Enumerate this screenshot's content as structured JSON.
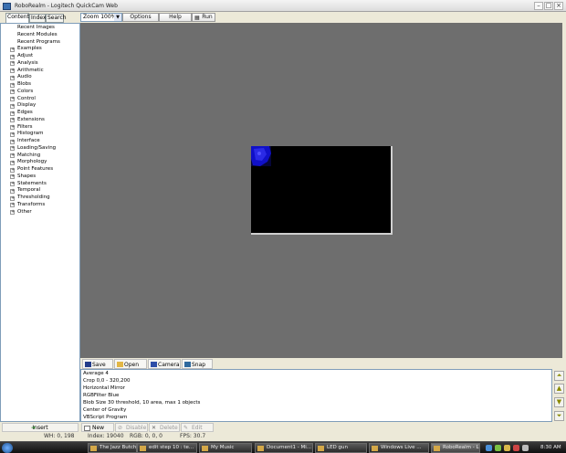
{
  "window": {
    "title": "RoboRealm - Logitech QuickCam Web"
  },
  "tabs": [
    "Contents",
    "Index",
    "Search"
  ],
  "toolbar": {
    "zoom_value": "Zoom 100%",
    "options": "Options",
    "help": "Help",
    "run": "Run"
  },
  "tree": {
    "items": [
      {
        "label": "Recent Images",
        "expandable": false
      },
      {
        "label": "Recent Modules",
        "expandable": false
      },
      {
        "label": "Recent Programs",
        "expandable": false
      },
      {
        "label": "Examples",
        "expandable": true
      },
      {
        "label": "Adjust",
        "expandable": true
      },
      {
        "label": "Analysis",
        "expandable": true
      },
      {
        "label": "Arithmetic",
        "expandable": true
      },
      {
        "label": "Audio",
        "expandable": true
      },
      {
        "label": "Blobs",
        "expandable": true
      },
      {
        "label": "Colors",
        "expandable": true
      },
      {
        "label": "Control",
        "expandable": true
      },
      {
        "label": "Display",
        "expandable": true
      },
      {
        "label": "Edges",
        "expandable": true
      },
      {
        "label": "Extensions",
        "expandable": true
      },
      {
        "label": "Filters",
        "expandable": true
      },
      {
        "label": "Histogram",
        "expandable": true
      },
      {
        "label": "Interface",
        "expandable": true
      },
      {
        "label": "Loading/Saving",
        "expandable": true
      },
      {
        "label": "Matching",
        "expandable": true
      },
      {
        "label": "Morphology",
        "expandable": true
      },
      {
        "label": "Point Features",
        "expandable": true
      },
      {
        "label": "Shapes",
        "expandable": true
      },
      {
        "label": "Statements",
        "expandable": true
      },
      {
        "label": "Temporal",
        "expandable": true
      },
      {
        "label": "Thresholding",
        "expandable": true
      },
      {
        "label": "Transforms",
        "expandable": true
      },
      {
        "label": "Other",
        "expandable": true
      }
    ]
  },
  "pipeline_toolbar": {
    "save": "Save",
    "open": "Open",
    "camera": "Camera",
    "snap": "Snap"
  },
  "pipeline": {
    "items": [
      "Average 4",
      "Crop 0,0 - 320,200",
      "Horizontal Mirror",
      "RGBFilter Blue",
      "Blob Size 30 threshold, 10 area, max 1 objects",
      "Center of Gravity",
      "VBScript Program"
    ]
  },
  "bottom_buttons": {
    "insert": "Insert",
    "new": "New",
    "disable": "Disable",
    "delete": "Delete",
    "edit": "Edit"
  },
  "status": {
    "wh": "WH: 0, 198",
    "index": "Index: 19040",
    "rgb": "RGB: 0, 0, 0",
    "fps": "FPS: 30.7"
  },
  "taskbar": {
    "tasks": [
      {
        "label": "The Jazz Butch...",
        "active": false
      },
      {
        "label": "edit step 10 : te...",
        "active": false
      },
      {
        "label": "My Music",
        "active": false
      },
      {
        "label": "Document1 - Mi...",
        "active": false
      },
      {
        "label": "LED gun",
        "active": false
      },
      {
        "label": "Windows Live ...",
        "active": false
      },
      {
        "label": "RoboRealm - L...",
        "active": true
      }
    ],
    "time": "8:30 AM"
  },
  "colors": {
    "canvas_bg": "#6e6e6e",
    "blob": "#1010c8",
    "taskbar": "#1a1a1a"
  },
  "icons": {
    "title": "roborealm-app-icon",
    "run": "run-icon",
    "save": "floppy-disk-icon",
    "open": "folder-open-icon",
    "camera": "camera-icon",
    "snap": "snapshot-icon",
    "insert": "insert-arrow-icon",
    "new": "new-document-icon",
    "disable": "disable-icon",
    "delete": "delete-x-icon",
    "edit": "edit-icon"
  }
}
